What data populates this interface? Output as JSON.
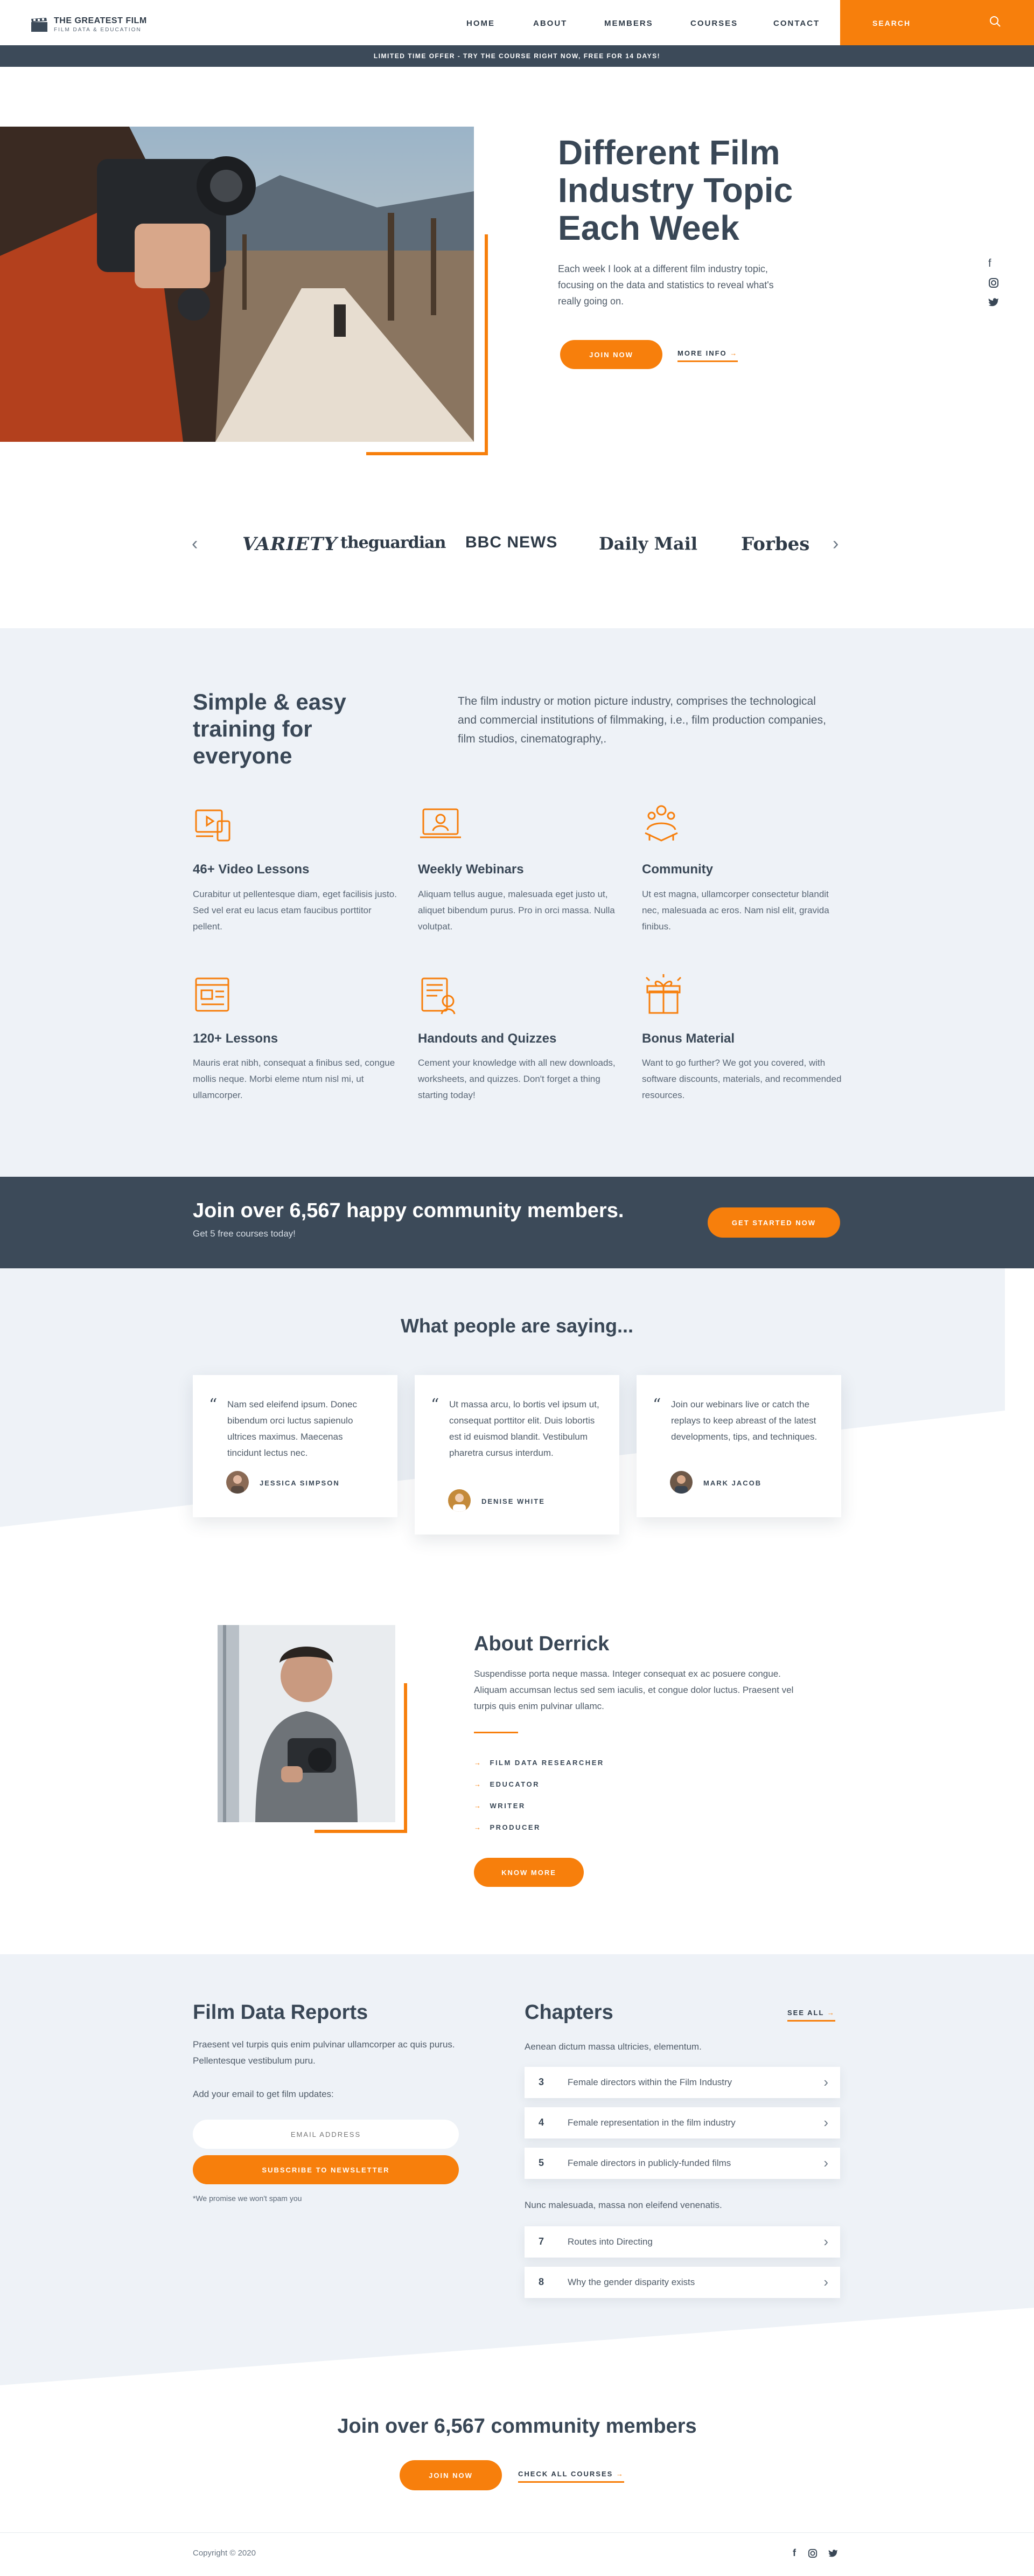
{
  "header": {
    "logo_title": "THE GREATEST FILM",
    "logo_subtitle": "FILM DATA & EDUCATION",
    "nav": [
      "HOME",
      "ABOUT",
      "MEMBERS",
      "COURSES",
      "CONTACT"
    ],
    "search_label": "SEARCH"
  },
  "promo_text": "LIMITED TIME OFFER - TRY THE COURSE RIGHT NOW, FREE FOR 14 DAYS!",
  "hero": {
    "title": "Different Film Industry Topic Each Week",
    "text": "Each week I look at a different film industry topic, focusing on the data and statistics to reveal what's really going on.",
    "primary_button": "JOIN NOW",
    "secondary_link": "MORE INFO"
  },
  "press": [
    "VARIETY",
    "theguardian",
    "BBC NEWS",
    "Daily Mail",
    "Forbes"
  ],
  "training": {
    "title": "Simple & easy training for everyone",
    "intro": "The film industry or motion picture industry, comprises the technological and commercial institutions of filmmaking, i.e., film production companies, film studios, cinematography,.",
    "features": [
      {
        "icon": "video-lessons-icon",
        "title": "46+ Video Lessons",
        "text": "Curabitur ut pellentesque diam, eget facilisis justo. Sed vel erat eu lacus etam faucibus porttitor pellent."
      },
      {
        "icon": "webinar-icon",
        "title": "Weekly Webinars",
        "text": "Aliquam tellus augue, malesuada eget justo ut, aliquet bibendum purus. Pro in orci massa. Nulla volutpat."
      },
      {
        "icon": "community-icon",
        "title": "Community",
        "text": "Ut est magna, ullamcorper consectetur blandit nec, malesuada ac eros. Nam nisl elit, gravida finibus."
      },
      {
        "icon": "lessons-icon",
        "title": "120+ Lessons",
        "text": "Mauris erat nibh, consequat a finibus sed, congue mollis neque. Morbi eleme ntum nisl mi, ut ullamcorper."
      },
      {
        "icon": "handouts-icon",
        "title": "Handouts and Quizzes",
        "text": "Cement your knowledge with all new downloads, worksheets, and quizzes. Don't forget a thing starting today!"
      },
      {
        "icon": "gift-icon",
        "title": "Bonus Material",
        "text": "Want to go further? We got you covered, with software discounts, materials, and recommended resources."
      }
    ]
  },
  "join_band": {
    "title": "Join over 6,567 happy community members.",
    "subtitle": "Get 5 free courses today!",
    "button": "GET STARTED NOW"
  },
  "testimonials": {
    "title": "What people are saying...",
    "items": [
      {
        "quote": "Nam sed eleifend ipsum. Donec bibendum orci luctus sapienulo ultrices maximus. Maecenas tincidunt lectus nec.",
        "name": "JESSICA SIMPSON"
      },
      {
        "quote": "Ut massa arcu, lo bortis vel ipsum ut, consequat porttitor elit. Duis lobortis est id euismod blandit. Vestibulum pharetra cursus interdum.",
        "name": "DENISE WHITE"
      },
      {
        "quote": "Join our webinars live or catch the replays to keep abreast of the latest developments, tips, and techniques.",
        "name": "MARK JACOB"
      }
    ]
  },
  "about": {
    "title": "About Derrick",
    "text": "Suspendisse porta neque massa. Integer consequat ex ac posuere congue. Aliquam accumsan lectus sed sem iaculis, et congue dolor luctus. Praesent vel turpis quis enim pulvinar ullamc.",
    "roles": [
      "FILM DATA RESEARCHER",
      "EDUCATOR",
      "WRITER",
      "PRODUCER"
    ],
    "button": "KNOW MORE"
  },
  "reports": {
    "title": "Film Data Reports",
    "text": "Praesent vel turpis quis enim pulvinar ullamcorper ac quis purus. Pellentesque vestibulum puru.",
    "email_prompt": "Add your email to get film updates:",
    "email_placeholder": "EMAIL ADDRESS",
    "button": "SUBSCRIBE TO NEWSLETTER",
    "note": "*We promise we won't spam you"
  },
  "chapters": {
    "title": "Chapters",
    "see_all": "SEE ALL",
    "group1_caption": "Aenean dictum massa ultricies, elementum.",
    "group1": [
      {
        "num": "3",
        "label": "Female directors within the Film Industry"
      },
      {
        "num": "4",
        "label": "Female representation in the film industry"
      },
      {
        "num": "5",
        "label": "Female directors in publicly-funded films"
      }
    ],
    "group2_caption": "Nunc malesuada, massa non eleifend venenatis.",
    "group2": [
      {
        "num": "7",
        "label": "Routes into Directing"
      },
      {
        "num": "8",
        "label": "Why the gender disparity exists"
      }
    ]
  },
  "footer": {
    "title": "Join over 6,567 community members",
    "join_button": "JOIN NOW",
    "courses_link": "CHECK ALL COURSES",
    "copyright": "Copyright © 2020"
  },
  "colors": {
    "accent": "#f77f0c",
    "dark": "#3c4a59",
    "light_bg": "#eef2f7"
  }
}
